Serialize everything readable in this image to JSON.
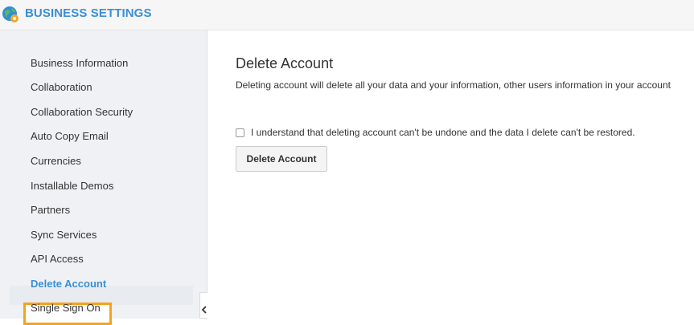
{
  "header": {
    "title": "BUSINESS SETTINGS",
    "logo_icon": "globe-gear-icon"
  },
  "sidebar": {
    "items": [
      {
        "label": "Business Information"
      },
      {
        "label": "Collaboration"
      },
      {
        "label": "Collaboration Security"
      },
      {
        "label": "Auto Copy Email"
      },
      {
        "label": "Currencies"
      },
      {
        "label": "Installable Demos"
      },
      {
        "label": "Partners"
      },
      {
        "label": "Sync Services"
      },
      {
        "label": "API Access"
      },
      {
        "label": "Delete Account",
        "active": true
      },
      {
        "label": "Single Sign On"
      }
    ],
    "collapse_icon": "chevron-left-icon",
    "highlight_color": "#f7a21b",
    "active_color": "#3a8ed8"
  },
  "main": {
    "title": "Delete Account",
    "description": "Deleting account will delete all your data and your information, other users information in your account",
    "confirm_label": "I understand that deleting account can't be undone and the data I delete can't be restored.",
    "confirm_checked": false,
    "delete_button_label": "Delete Account"
  }
}
